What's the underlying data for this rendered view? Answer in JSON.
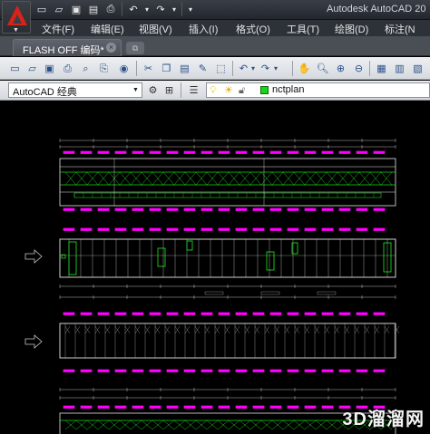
{
  "app": {
    "title": "Autodesk AutoCAD 20",
    "logo_icon": "autocad-a-logo",
    "brand_color": "#d8231a"
  },
  "quick_access": [
    {
      "name": "new-icon",
      "glyph": "▭"
    },
    {
      "name": "open-icon",
      "glyph": "▱"
    },
    {
      "name": "save-icon",
      "glyph": "▣"
    },
    {
      "name": "save-as-icon",
      "glyph": "▤"
    },
    {
      "name": "print-icon",
      "glyph": "⎙"
    },
    {
      "name": "undo-icon",
      "glyph": "↶"
    },
    {
      "name": "undo-dropdown-icon",
      "glyph": "▾"
    },
    {
      "name": "redo-icon",
      "glyph": "↷"
    },
    {
      "name": "redo-dropdown-icon",
      "glyph": "▾"
    },
    {
      "name": "customize-icon",
      "glyph": "▾"
    }
  ],
  "menu": [
    "文件(F)",
    "编辑(E)",
    "视图(V)",
    "插入(I)",
    "格式(O)",
    "工具(T)",
    "绘图(D)",
    "标注(N"
  ],
  "tabs": {
    "active": "FLASH OFF 编码*",
    "close_glyph": "×",
    "new_tab_glyph": "⧉"
  },
  "toolbar": [
    "new-icon",
    "open-icon",
    "save-icon",
    "print-icon",
    "plot-preview-icon",
    "publish-icon",
    "3d-print-icon",
    "cut-icon",
    "copy-icon",
    "paste-icon",
    "match-properties-icon",
    "block-editor-icon",
    "undo-icon",
    "redo-icon",
    "pan-icon",
    "zoom-realtime-icon",
    "zoom-window-icon",
    "zoom-previous-icon",
    "properties-icon",
    "design-center-icon",
    "tool-palettes-icon",
    "sheet-set-icon",
    "markup-icon",
    "calculator-icon"
  ],
  "workspace": {
    "value": "AutoCAD 经典",
    "settings_icon": "workspace-settings-icon",
    "lock_icon": "toolbar-lock-icon"
  },
  "layer": {
    "manager_icon": "layer-properties-icon",
    "state_icons": [
      "bulb-on-icon",
      "sun-freeze-icon",
      "lock-open-icon"
    ],
    "current": "nctplan",
    "color": "#19d619"
  },
  "drawing": {
    "background": "#000000",
    "line_color": "#e8e8e8",
    "accent_magenta": "#ff00ff",
    "accent_green": "#19d619",
    "arrow_color": "#c8c8c8"
  },
  "watermark": "3D溜溜网"
}
